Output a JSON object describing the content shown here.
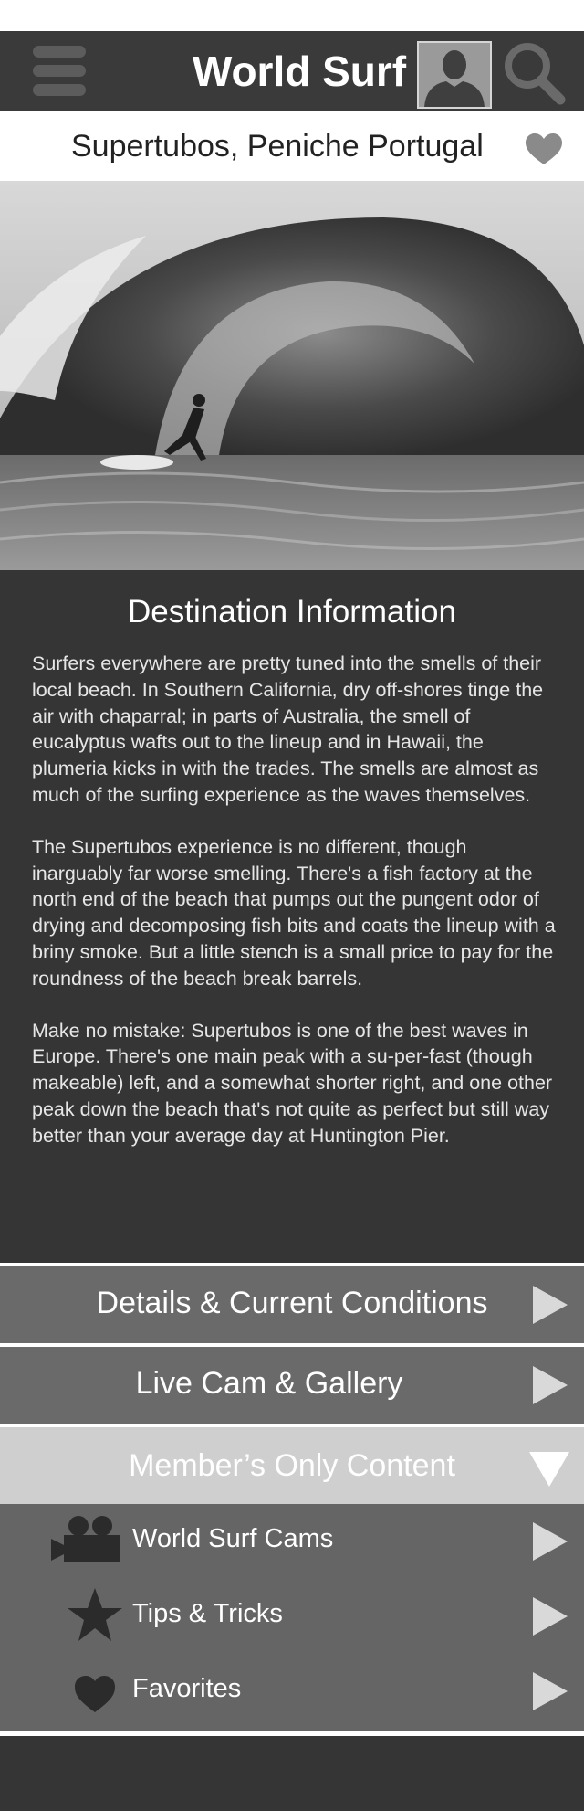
{
  "header": {
    "title": "World Surf",
    "menu_icon": "hamburger-menu-icon",
    "avatar_icon": "user-avatar-icon",
    "search_icon": "search-icon"
  },
  "location": {
    "name": "Supertubos, Peniche Portugal",
    "favorite_icon": "heart-icon"
  },
  "hero": {
    "description_icon": "surfer-wave-photo"
  },
  "destination": {
    "title": "Destination Information",
    "paragraphs": [
      "Surfers everywhere are pretty tuned into the smells of their local beach. In Southern California, dry off-shores tinge the air with chaparral; in parts of Australia, the smell of eucalyptus wafts out to the lineup and in Hawaii, the plumeria kicks in with the trades. The smells are almost as much of the surfing experience as the waves themselves.",
      "The Supertubos experience is no different, though inarguably far worse smelling. There's a fish factory at the north end of the beach that pumps out the pungent odor of drying and decomposing fish bits and coats the lineup with a briny smoke. But a little stench is a small price to pay for the roundness of the beach break barrels.",
      "Make no mistake: Supertubos is one of the best waves in Europe. There's one main peak with a su-per-fast (though makeable) left, and a somewhat shorter right, and one other peak down the beach that's not quite as perfect but still way better than your average day at Huntington Pier."
    ]
  },
  "menu": {
    "details": "Details & Current Conditions",
    "livecam": "Live Cam & Gallery",
    "members": "Member’s Only Content",
    "sub": [
      {
        "label": "World Surf Cams",
        "icon": "video-camera-icon"
      },
      {
        "label": "Tips & Tricks",
        "icon": "star-icon"
      },
      {
        "label": "Favorites",
        "icon": "heart-icon"
      }
    ]
  },
  "colors": {
    "topbar": "#3a3a3a",
    "panel": "#353535",
    "menu": "#6a6a6a",
    "members": "#cfcfcf",
    "arrow": "#d9d9d9"
  }
}
